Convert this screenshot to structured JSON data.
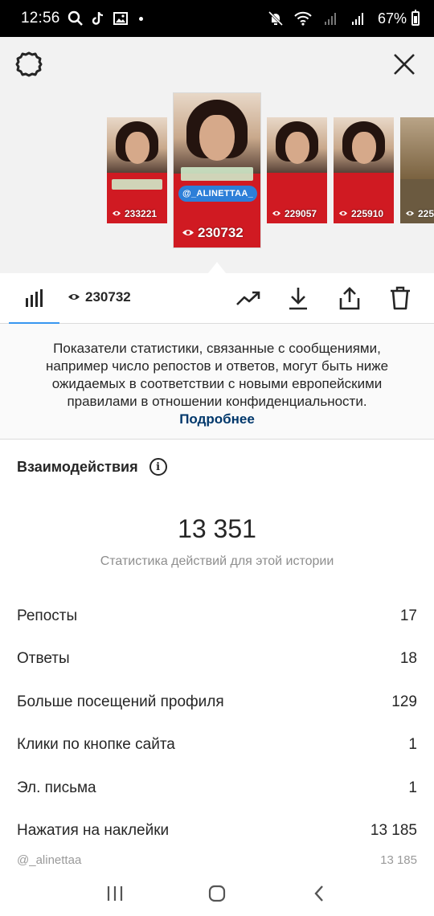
{
  "status_bar": {
    "time": "12:56",
    "battery_percent": "67%",
    "left_icons": [
      "search-icon",
      "tiktok-icon",
      "gallery-icon",
      "dot-icon"
    ],
    "right_icons": [
      "mute-icon",
      "wifi-icon",
      "signal-icon",
      "signal-icon",
      "battery-icon"
    ]
  },
  "story_header": {
    "settings_icon": "gear-icon",
    "close_icon": "close-icon",
    "stories": [
      {
        "views": "233221"
      },
      {
        "views": "230732",
        "selected": true,
        "mention": "@_ALINETTAA_"
      },
      {
        "views": "229057"
      },
      {
        "views": "225910"
      },
      {
        "views": "225"
      }
    ]
  },
  "toolbar": {
    "views": "230732",
    "icons": [
      "bar-chart-icon",
      "eye-icon",
      "trending-icon",
      "download-icon",
      "share-icon",
      "trash-icon"
    ]
  },
  "notice": {
    "text": "Показатели статистики, связанные с сообщениями, например число репостов и ответов, могут быть ниже ожидаемых в соответствии с новыми европейскими правилами в отношении конфиденциальности.",
    "link": "Подробнее"
  },
  "interactions": {
    "title": "Взаимодействия",
    "total": "13 351",
    "caption": "Статистика действий для этой истории",
    "rows": [
      {
        "label": "Репосты",
        "value": "17"
      },
      {
        "label": "Ответы",
        "value": "18"
      },
      {
        "label": "Больше посещений профиля",
        "value": "129"
      },
      {
        "label": "Клики по кнопке сайта",
        "value": "1"
      },
      {
        "label": "Эл. письма",
        "value": "1"
      },
      {
        "label": "Нажатия на наклейки",
        "value": "13 185"
      }
    ],
    "sub_row": {
      "label": "@_alinettaa",
      "value": "13 185"
    }
  },
  "nav_bar": {
    "icons": [
      "recents-icon",
      "home-icon",
      "back-icon"
    ]
  },
  "colors": {
    "accent": "#3897f0",
    "link": "#00376b",
    "muted": "#8e8e8e"
  }
}
